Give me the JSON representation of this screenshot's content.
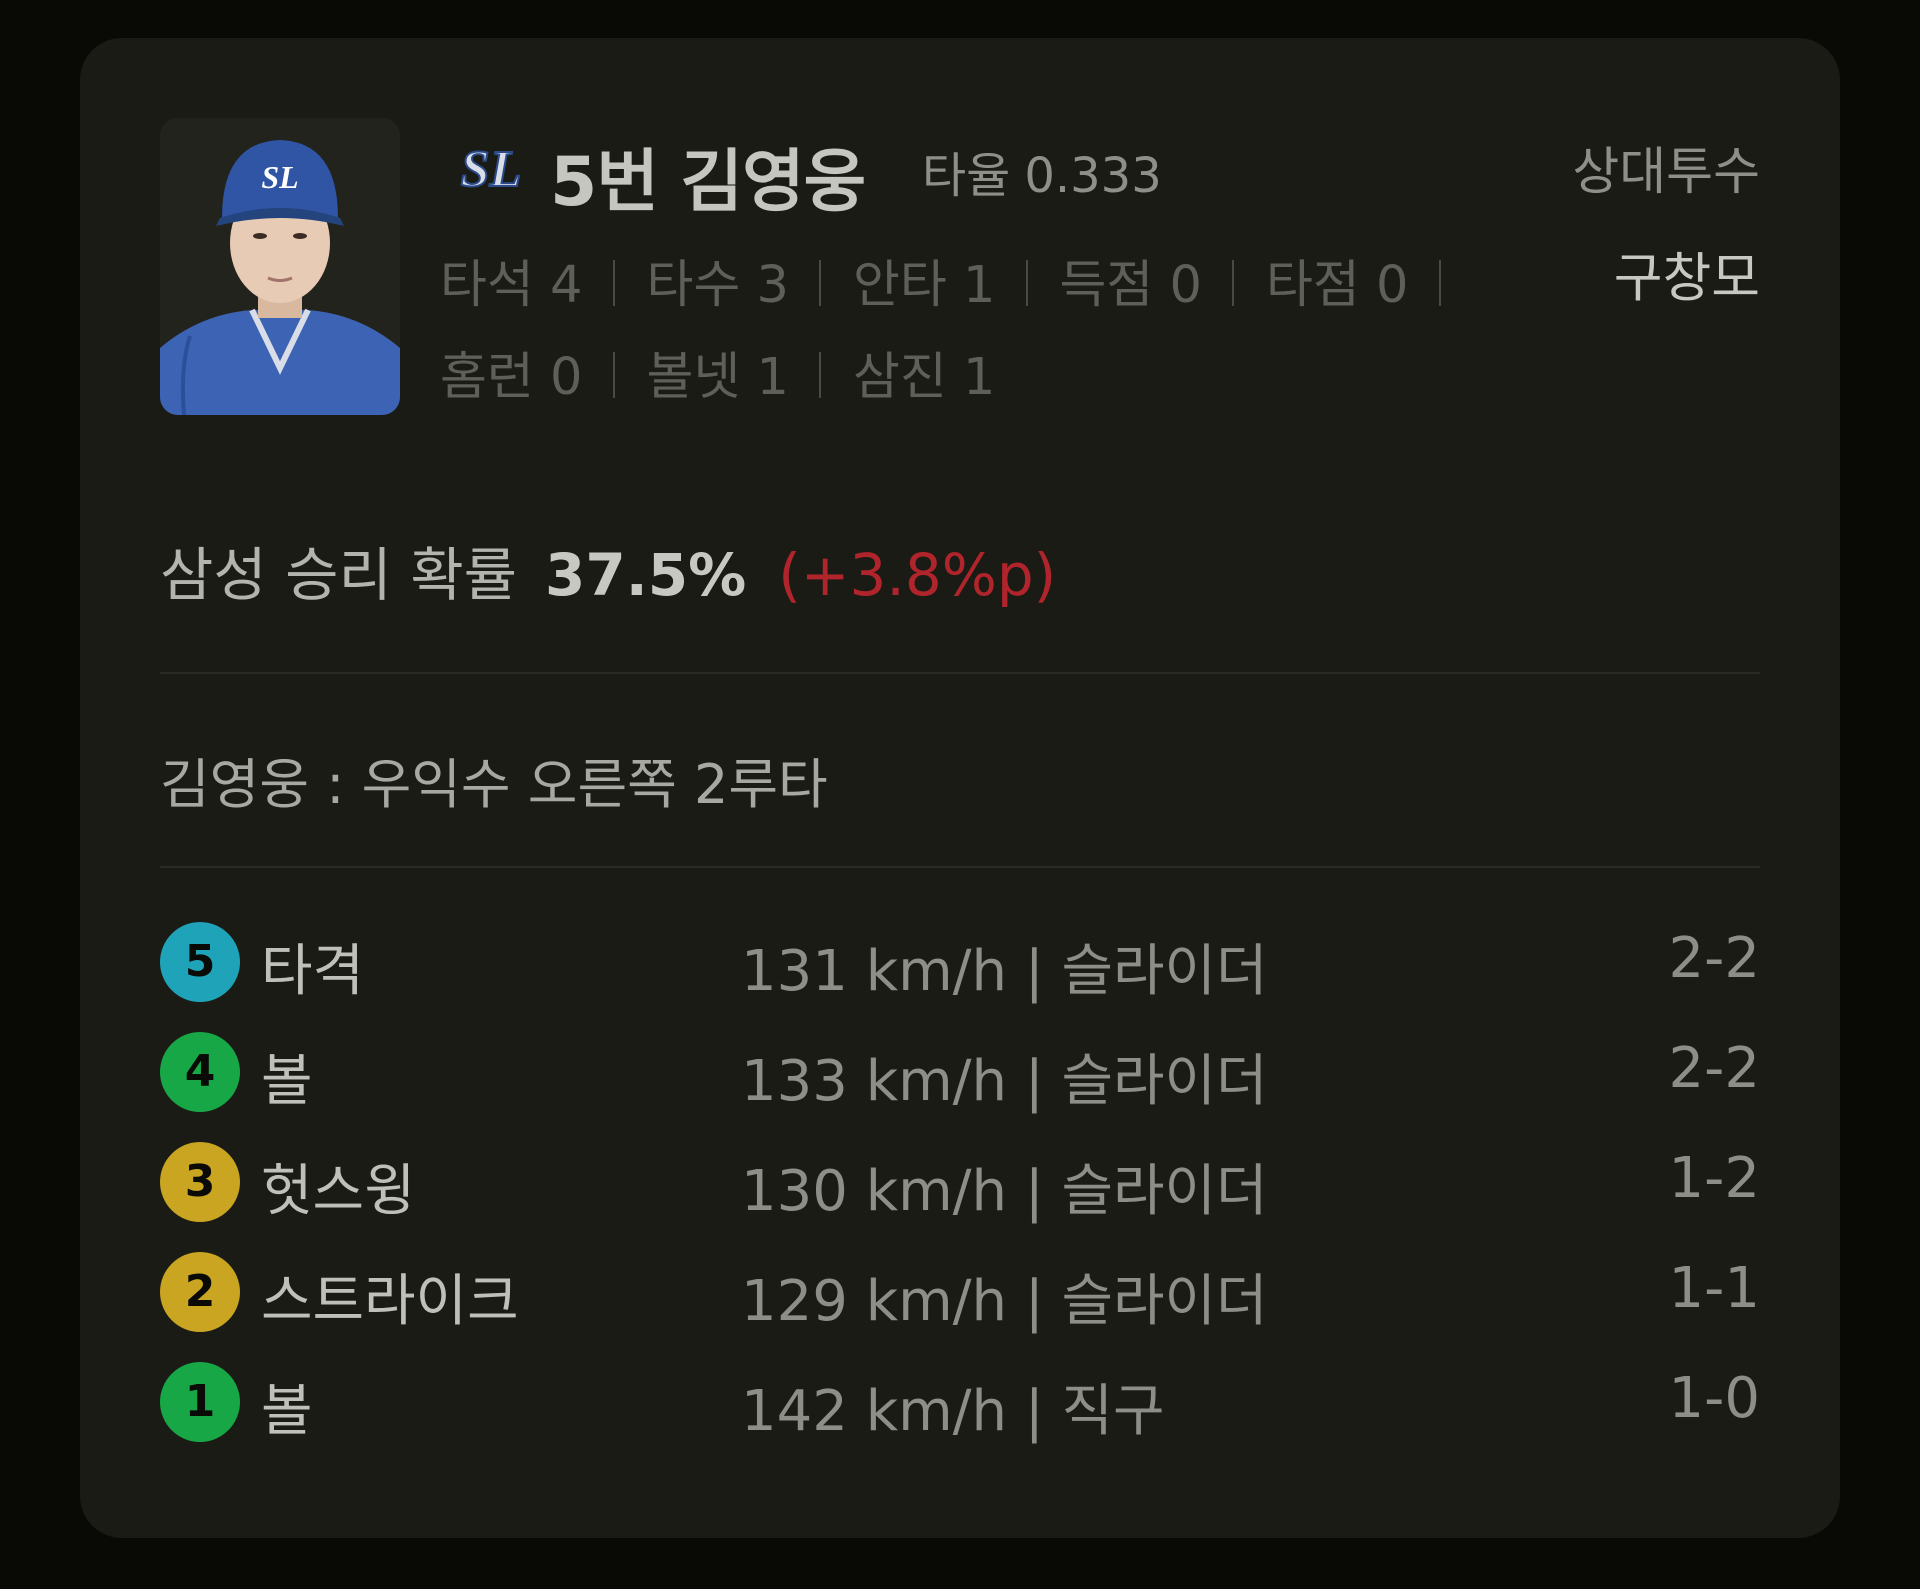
{
  "batter": {
    "team_logo": "SL",
    "order_name": "5번 김영웅",
    "avg_label": "타율",
    "avg_value": "0.333",
    "photo_icon": "player-portrait",
    "stats": [
      {
        "text": "타석 4"
      },
      {
        "text": "타수 3"
      },
      {
        "text": "안타 1"
      },
      {
        "text": "득점 0"
      },
      {
        "text": "타점 0"
      },
      {
        "text": "홈런 0"
      },
      {
        "text": "볼넷 1"
      },
      {
        "text": "삼진 1"
      }
    ]
  },
  "opponent": {
    "label": "상대투수",
    "name": "구창모"
  },
  "win_probability": {
    "label": "삼성 승리 확률",
    "value": "37.5%",
    "delta": "(+3.8%p)",
    "delta_color": "#b0242c"
  },
  "play": {
    "description": "김영웅 : 우익수 오른쪽 2루타"
  },
  "pitches": [
    {
      "number": "5",
      "result": "타격",
      "info": "131 km/h | 슬라이더",
      "count": "2-2",
      "color": "#1fa3b8"
    },
    {
      "number": "4",
      "result": "볼",
      "info": "133 km/h | 슬라이더",
      "count": "2-2",
      "color": "#17a747"
    },
    {
      "number": "3",
      "result": "헛스윙",
      "info": "130 km/h | 슬라이더",
      "count": "1-2",
      "color": "#c9a522"
    },
    {
      "number": "2",
      "result": "스트라이크",
      "info": "129 km/h | 슬라이더",
      "count": "1-1",
      "color": "#c9a522"
    },
    {
      "number": "1",
      "result": "볼",
      "info": "142 km/h | 직구",
      "count": "1-0",
      "color": "#17a747"
    }
  ]
}
